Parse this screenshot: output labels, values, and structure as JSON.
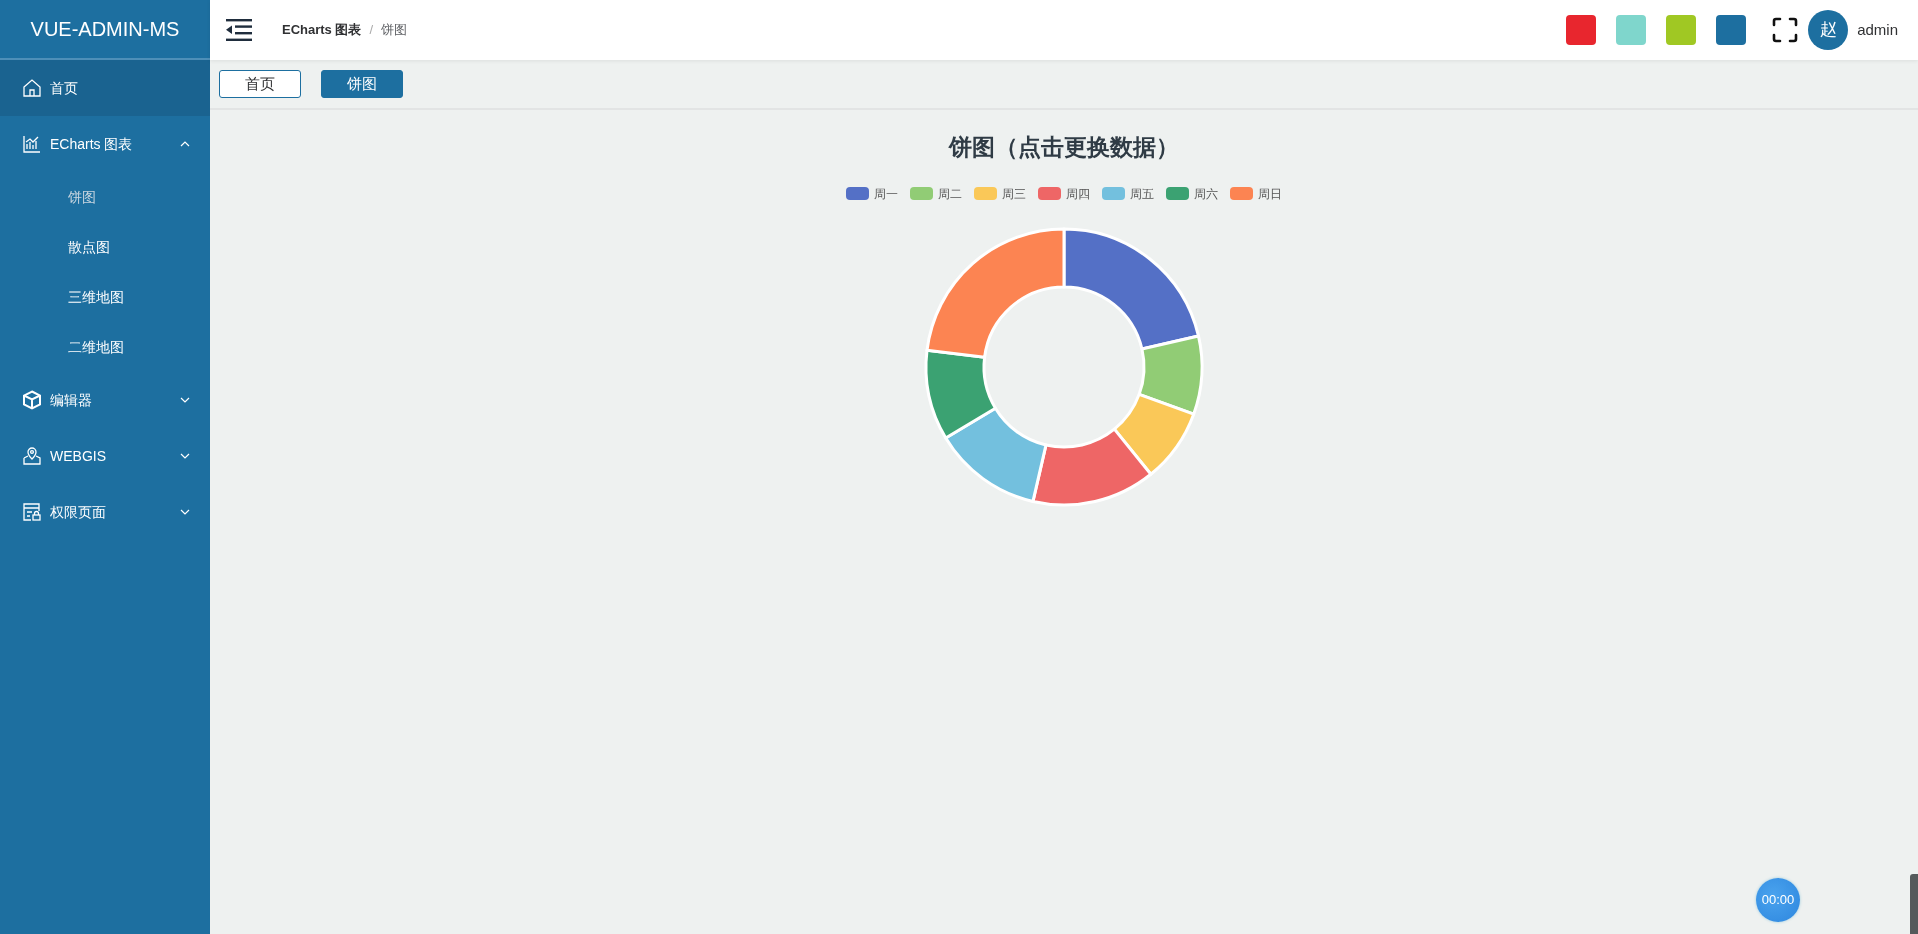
{
  "sidebar": {
    "logo": "VUE-ADMIN-MS",
    "items": [
      {
        "label": "首页",
        "highlighted": true
      },
      {
        "label": "ECharts 图表",
        "highlighted": false,
        "expanded": true,
        "children": [
          {
            "label": "饼图",
            "selected": true
          },
          {
            "label": "散点图",
            "selected": false
          },
          {
            "label": "三维地图",
            "selected": false
          },
          {
            "label": "二维地图",
            "selected": false
          }
        ]
      },
      {
        "label": "编辑器",
        "highlighted": false,
        "expanded": false
      },
      {
        "label": "WEBGIS",
        "highlighted": false,
        "expanded": false
      },
      {
        "label": "权限页面",
        "highlighted": false,
        "expanded": false
      }
    ]
  },
  "header": {
    "breadcrumb": [
      {
        "label": "ECharts 图表",
        "current": false
      },
      {
        "label": "饼图",
        "current": true
      }
    ],
    "separator": "/",
    "theme_colors": [
      {
        "color": "#e8262e"
      },
      {
        "color": "#7fd6cc"
      },
      {
        "color": "#a0c823"
      },
      {
        "color": "#1d6fa0"
      }
    ],
    "avatar": "赵",
    "user": "admin"
  },
  "tabs": [
    {
      "label": "首页",
      "selected": false
    },
    {
      "label": "饼图",
      "selected": true
    }
  ],
  "chart": {
    "title": "饼图（点击更换数据）",
    "legend": [
      {
        "label": "周一",
        "color": "#5470c6"
      },
      {
        "label": "周二",
        "color": "#91cc75"
      },
      {
        "label": "周三",
        "color": "#fac858"
      },
      {
        "label": "周四",
        "color": "#ee6666"
      },
      {
        "label": "周五",
        "color": "#73c0de"
      },
      {
        "label": "周六",
        "color": "#3ba272"
      },
      {
        "label": "周日",
        "color": "#fc8452"
      }
    ]
  },
  "timer": "00:00"
}
